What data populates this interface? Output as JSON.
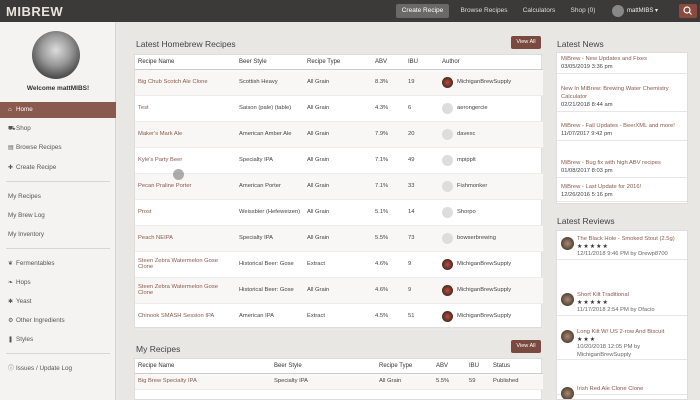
{
  "brand": {
    "logo_text": "MIBREW",
    "accent": "#8a5a4e"
  },
  "nav": {
    "items": [
      {
        "label": "Create Recipe",
        "active": true
      },
      {
        "label": "Browse Recipes",
        "active": false
      },
      {
        "label": "Calculators",
        "active": false
      },
      {
        "label": "Shop (0)",
        "active": false
      }
    ],
    "user": "mattMIBS ▾"
  },
  "sidebar": {
    "welcome": "Welcome mattMIBS!",
    "items": [
      {
        "label": "Home",
        "icon": "home-icon",
        "glyph": "⌂"
      },
      {
        "label": "Shop",
        "icon": "cart-icon",
        "glyph": "⛟"
      },
      {
        "label": "Browse Recipes",
        "icon": "book-icon",
        "glyph": "▤"
      },
      {
        "label": "Create Recipe",
        "icon": "plus-icon",
        "glyph": "✚"
      },
      {
        "label": "My Recipes",
        "icon": "",
        "glyph": ""
      },
      {
        "label": "My Brew Log",
        "icon": "",
        "glyph": ""
      },
      {
        "label": "My Inventory",
        "icon": "",
        "glyph": ""
      },
      {
        "label": "Fermentables",
        "icon": "grain-icon",
        "glyph": "❦"
      },
      {
        "label": "Hops",
        "icon": "hop-icon",
        "glyph": "❧"
      },
      {
        "label": "Yeast",
        "icon": "yeast-icon",
        "glyph": "✱"
      },
      {
        "label": "Other Ingredients",
        "icon": "gear-icon",
        "glyph": "⚙"
      },
      {
        "label": "Styles",
        "icon": "bottle-icon",
        "glyph": "❚"
      },
      {
        "label": "Issues / Update Log",
        "icon": "info-icon",
        "glyph": "ⓘ"
      }
    ]
  },
  "latest": {
    "title": "Latest Homebrew Recipes",
    "view_all": "View All",
    "headers": [
      "Recipe Name",
      "Beer Style",
      "Recipe Type",
      "ABV",
      "IBU",
      "Author"
    ],
    "rows": [
      [
        "Big Chub Scotch Ale Clone",
        "Scottish Heavy",
        "All Grain",
        "8.3%",
        "19",
        "MichiganBrewSupply",
        "mbs"
      ],
      [
        "Test",
        "Saison (pale) (table)",
        "All Grain",
        "4.3%",
        "6",
        "aerongercie",
        "def"
      ],
      [
        "Maker's Mark Ale",
        "American Amber Ale",
        "All Grain",
        "7.9%",
        "20",
        "davexc",
        "def"
      ],
      [
        "Kyle's Party Beer",
        "Specialty IPA",
        "All Grain",
        "7.1%",
        "49",
        "mpipplt",
        "def"
      ],
      [
        "Pecan Praline Porter",
        "American Porter",
        "All Grain",
        "7.1%",
        "33",
        "Fishmonker",
        "def"
      ],
      [
        "Prost",
        "Weissbier (Hefeweizen)",
        "All Grain",
        "5.1%",
        "14",
        "Shorpo",
        "def"
      ],
      [
        "Peach NEIPA",
        "Specialty IPA",
        "All Grain",
        "5.5%",
        "73",
        "bowserbrewing",
        "def"
      ],
      [
        "Steen Zebra Watermelon Gose Clone",
        "Historical Beer: Gose",
        "Extract",
        "4.6%",
        "9",
        "MichiganBrewSupply",
        "mbs"
      ],
      [
        "Steen Zebra Watermelon Gose Clone",
        "Historical Beer: Gose",
        "All Grain",
        "4.6%",
        "9",
        "MichiganBrewSupply",
        "mbs"
      ],
      [
        "Chinook SMASH Session IPA",
        "American IPA",
        "Extract",
        "4.5%",
        "51",
        "MichiganBrewSupply",
        "mbs"
      ]
    ]
  },
  "my_recipes": {
    "title": "My Recipes",
    "view_all": "View All",
    "headers": [
      "Recipe Name",
      "Beer Style",
      "Recipe Type",
      "ABV",
      "IBU",
      "Status"
    ],
    "rows": [
      [
        "Big Brew Specialty IPA",
        "Specialty IPA",
        "All Grain",
        "5.5%",
        "59",
        "Published"
      ]
    ]
  },
  "news": {
    "title": "Latest News",
    "items": [
      {
        "title": "MiBrew - New Updates and Fixes",
        "date": "03/05/2019 3:36 pm"
      },
      {
        "title": "New In MiBrew: Brewing Water Chemistry Calculator",
        "date": "02/21/2018 8:44 am"
      },
      {
        "title": "MiBrew - Fall Updates - BeerXML and more!",
        "date": "11/07/2017 9:42 pm"
      },
      {
        "title": "MiBrew - Bug fix with high ABV recipes",
        "date": "01/08/2017 8:03 pm"
      },
      {
        "title": "MiBrew - Last Update for 2016!",
        "date": "12/26/2016 5:16 pm"
      }
    ]
  },
  "reviews": {
    "title": "Latest Reviews",
    "items": [
      {
        "title": "The Black Hole - Smoked Stout (2.5g)",
        "stars": "★★★★★",
        "meta": "12/11/2018 9:46 PM by Drewp8700"
      },
      {
        "title": "Short Kilt Traditional",
        "stars": "★★★★★",
        "meta": "11/17/2018 2:54 PM by Dfacio"
      },
      {
        "title": "Long Kilt W/ US 2-row And Biscuit",
        "stars": "★★★",
        "meta": "10/20/2018 12:05 PM by MichiganBrewSupply"
      },
      {
        "title": "Irish Red Ale Clone Clone",
        "stars": "",
        "meta": ""
      }
    ]
  }
}
